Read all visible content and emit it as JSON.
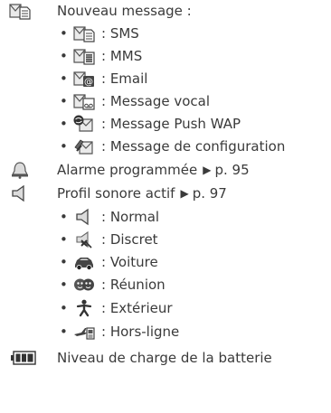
{
  "items": [
    {
      "icon": "new-message-icon",
      "label": "Nouveau message :",
      "children": [
        {
          "icon": "sms-icon",
          "label": ": SMS"
        },
        {
          "icon": "mms-icon",
          "label": ": MMS"
        },
        {
          "icon": "email-icon",
          "label": ": Email"
        },
        {
          "icon": "voicemail-icon",
          "label": ": Message vocal"
        },
        {
          "icon": "wap-push-icon",
          "label": ": Message Push WAP"
        },
        {
          "icon": "configuration-message-icon",
          "label": ": Message de configuration"
        }
      ]
    },
    {
      "icon": "alarm-bell-icon",
      "label": "Alarme programmée",
      "ref_arrow": "▶",
      "ref": "p. 95"
    },
    {
      "icon": "speaker-icon",
      "label": "Profil sonore actif",
      "ref_arrow": "▶",
      "ref": "p. 97",
      "children": [
        {
          "icon": "speaker-normal-icon",
          "label": ": Normal"
        },
        {
          "icon": "speaker-muted-icon",
          "label": ": Discret"
        },
        {
          "icon": "car-icon",
          "label": ": Voiture"
        },
        {
          "icon": "meeting-faces-icon",
          "label": ": Réunion"
        },
        {
          "icon": "outdoor-person-icon",
          "label": ": Extérieur"
        },
        {
          "icon": "offline-airplane-icon",
          "label": ": Hors-ligne"
        }
      ]
    },
    {
      "icon": "battery-icon",
      "label": "Niveau de charge de la batterie"
    }
  ]
}
